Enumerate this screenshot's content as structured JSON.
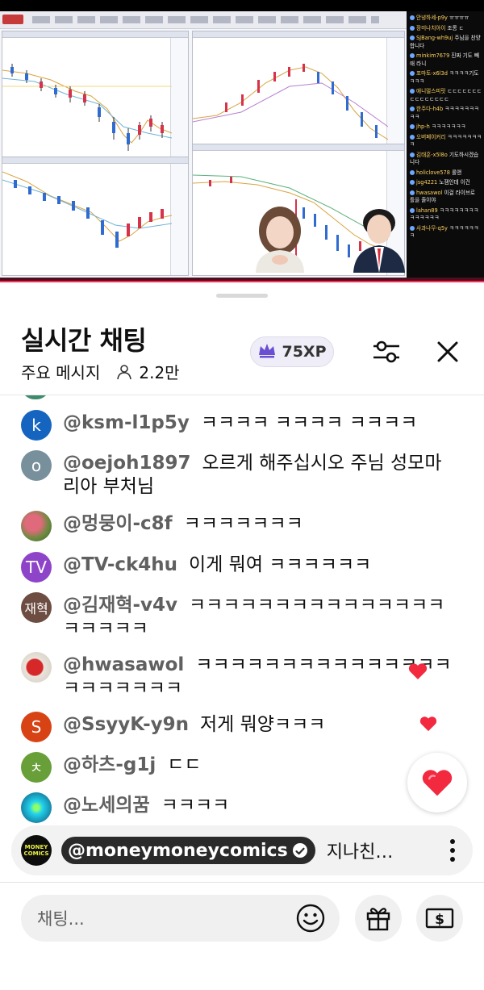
{
  "stream": {
    "side_chat": [
      {
        "user": "안녕하세-p9y",
        "text": "ㅠㅠㅠㅠ"
      },
      {
        "user": "장미나치아이",
        "text": "조롱 ㄷ"
      },
      {
        "user": "SJBang-wh9uj",
        "text": "주님을 찬양합니다"
      },
      {
        "user": "minkim7679",
        "text": "진짜 기도 빼애 라니"
      },
      {
        "user": "포마토-x6l3d",
        "text": "ㅋㅋㅋㅋ기도 ㅋㅋㅋ"
      },
      {
        "user": "애니멀스피릿",
        "text": "ㄷㄷㄷㄷㄷㄷㄷㄷㄷㄷㄷㄷㄷㄷㄷ"
      },
      {
        "user": "한주다-h4b",
        "text": "ㅋㅋㅋㅋㅋㅋㅋㅋㅋ"
      },
      {
        "user": "jhp-h",
        "text": "ㅋㅋㅋㅋㅋㅋㅋ"
      },
      {
        "user": "오버페이커리",
        "text": "ㅋㅋㅋㅋㅋㅋㅋㅋ"
      },
      {
        "user": "김태훈-x5l8o",
        "text": "기도하시겠습니다"
      },
      {
        "user": "holiclove578",
        "text": "롤앤"
      },
      {
        "user": "jsg4221",
        "text": "노잼인데 이건"
      },
      {
        "user": "hwasawol",
        "text": "이걸 라이브로 틀을 줄이야"
      },
      {
        "user": "lahan89",
        "text": "ㅋㅋㅋㅋㅋㅋㅋㅋㅋㅋㅋㅋㅋㅋ"
      },
      {
        "user": "사과나무-q5y",
        "text": "ㅋㅋㅋㅋㅋㅋㅋ"
      }
    ]
  },
  "header": {
    "title": "실시간 채팅",
    "mode": "주요 메시지",
    "viewers": "2.2만",
    "xp": "75XP"
  },
  "messages": [
    {
      "initial": "k",
      "color": "#1565c0",
      "author": "@ksm-l1p5y",
      "text": "ㅋㅋㅋㅋ ㅋㅋㅋㅋ ㅋㅋㅋㅋ"
    },
    {
      "initial": "o",
      "color": "#78909c",
      "author": "@oejoh1897",
      "text": "오르게 해주십시오 주님 성모마리아 부처님"
    },
    {
      "initial": "",
      "color": "#8d6e63",
      "author": "@멍뭉이-c8f",
      "text": "ㅋㅋㅋㅋㅋㅋㅋ"
    },
    {
      "initial": "TV",
      "color": "#8e44c9",
      "author": "@TV-ck4hu",
      "text": "이게 뭐여 ㅋㅋㅋㅋㅋㅋ"
    },
    {
      "initial": "재혁",
      "color": "#6d4c41",
      "author": "@김재혁-v4v",
      "text": "ㅋㅋㅋㅋㅋㅋㅋㅋㅋㅋㅋㅋㅋㅋㅋㅋㅋㅋㅋㅋ"
    },
    {
      "initial": "",
      "color": "#c62828",
      "author": "@hwasawol",
      "text": "ㅋㅋㅋㅋㅋㅋㅋㅋㅋㅋㅋㅋㅋㅋㅋㅋㅋㅋㅋㅋㅋㅋ"
    },
    {
      "initial": "S",
      "color": "#d84315",
      "author": "@SsyyK-y9n",
      "text": "저게 뭐양ㅋㅋㅋ"
    },
    {
      "initial": "ㅊ",
      "color": "#689f38",
      "author": "@하츠-g1j",
      "text": "ㄷㄷ"
    },
    {
      "initial": "",
      "color": "#00bcd4",
      "author": "@노세의꿈",
      "text": "ㅋㅋㅋㅋ"
    }
  ],
  "pinned": {
    "logo_text": "MONEY COMICS",
    "author": "@moneymoneycomics",
    "text": "지나친…"
  },
  "composer": {
    "placeholder": "채팅..."
  },
  "icons": {
    "person": "person-icon",
    "crown": "crown-icon",
    "tune": "sliders-icon",
    "close": "close-icon",
    "more": "more-vert-icon",
    "verified": "verified-check-icon",
    "emoji": "emoji-icon",
    "gift": "gift-icon",
    "super_chat": "dollar-bill-icon",
    "heart": "heart-icon"
  },
  "colors": {
    "accent_red": "#ff2d55",
    "xp_bg": "#efeef8",
    "crown": "#6a4fd3"
  }
}
